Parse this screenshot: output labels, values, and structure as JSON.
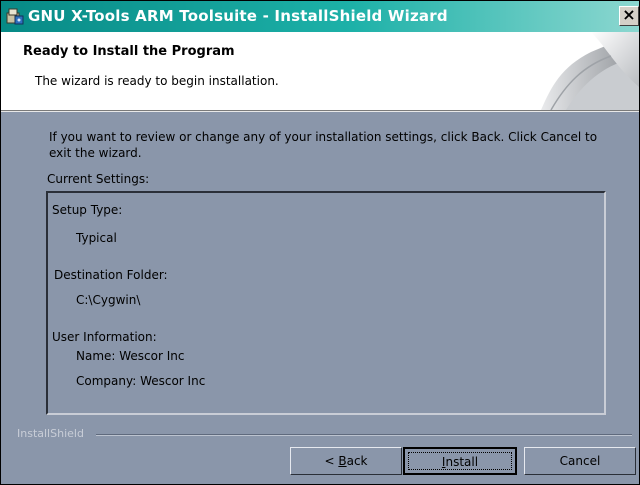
{
  "window": {
    "title": "GNU X-Tools ARM Toolsuite - InstallShield Wizard",
    "close_glyph": "×"
  },
  "header": {
    "title": "Ready to Install the Program",
    "subtitle": "The wizard is ready to begin installation."
  },
  "body": {
    "intro": "If you want to review or change any of your installation settings, click Back. Click Cancel to exit the wizard.",
    "settings_label": "Current Settings:",
    "settings": {
      "setup_type_label": "Setup Type:",
      "setup_type_value": "Typical",
      "destination_label": "Destination Folder:",
      "destination_value": "C:\\Cygwin\\",
      "user_info_label": "User Information:",
      "user_name": "Name: Wescor Inc",
      "user_company": "Company: Wescor Inc"
    }
  },
  "footer": {
    "brand": "InstallShield",
    "back_label_prefix": "< ",
    "back_label_accel": "B",
    "back_label_rest": "ack",
    "install_label_accel": "I",
    "install_label_rest": "nstall",
    "cancel_label": "Cancel"
  }
}
